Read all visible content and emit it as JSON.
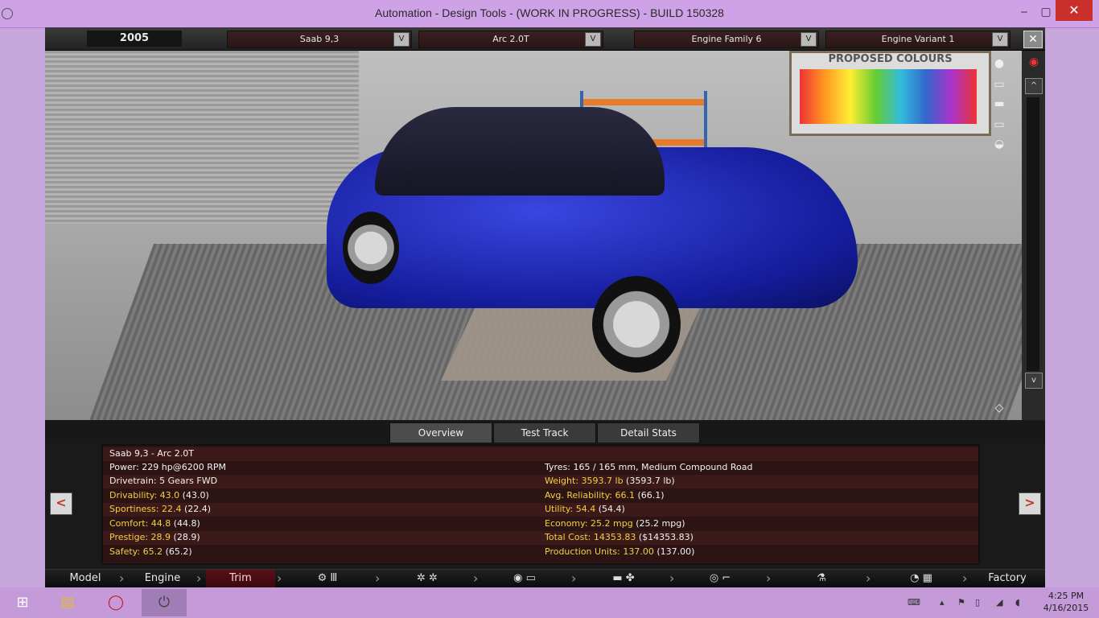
{
  "window": {
    "title": "Automation - Design Tools - (WORK IN PROGRESS) - BUILD 150328",
    "min": "‒",
    "max": "▢",
    "close": "✕"
  },
  "topbar": {
    "year": "2005",
    "model": "Saab 9,3",
    "trim": "Arc 2.0T",
    "engine_family": "Engine Family 6",
    "engine_variant": "Engine Variant 1",
    "dropdown_glyph": "V",
    "close_glyph": "✕"
  },
  "viewport": {
    "board_label": "PROPOSED COLOURS",
    "scroll_up": "^",
    "scroll_down": "v"
  },
  "tabs": [
    "Overview",
    "Test Track",
    "Detail Stats"
  ],
  "stats": {
    "title": "Saab 9,3 - Arc 2.0T",
    "power": "Power: 229 hp@6200 RPM",
    "drivetrain": "Drivetrain: 5 Gears FWD",
    "tyres": "Tyres: 165 / 165 mm, Medium Compound Road",
    "left": [
      {
        "label": "Drivability: 43.0",
        "extra": " (43.0)"
      },
      {
        "label": "Sportiness: 22.4",
        "extra": " (22.4)"
      },
      {
        "label": "Comfort: 44.8",
        "extra": " (44.8)"
      },
      {
        "label": "Prestige: 28.9",
        "extra": " (28.9)"
      },
      {
        "label": "Safety: 65.2",
        "extra": " (65.2)"
      }
    ],
    "right": [
      {
        "label": "Weight: 3593.7 lb",
        "extra": " (3593.7 lb)"
      },
      {
        "label": "Avg. Reliability: 66.1",
        "extra": " (66.1)"
      },
      {
        "label": "Utility: 54.4",
        "extra": " (54.4)"
      },
      {
        "label": "Economy: 25.2 mpg",
        "extra": " (25.2 mpg)"
      },
      {
        "label": "Total Cost: 14353.83",
        "extra": " ($14353.83)"
      },
      {
        "label": "Production Units: 137.00",
        "extra": " (137.00)"
      }
    ]
  },
  "nav": {
    "prev": "<",
    "next": ">"
  },
  "bottombar": {
    "model": "Model",
    "engine": "Engine",
    "trim": "Trim",
    "factory": "Factory"
  },
  "taskbar": {
    "time": "4:25 PM",
    "date": "4/16/2015"
  }
}
